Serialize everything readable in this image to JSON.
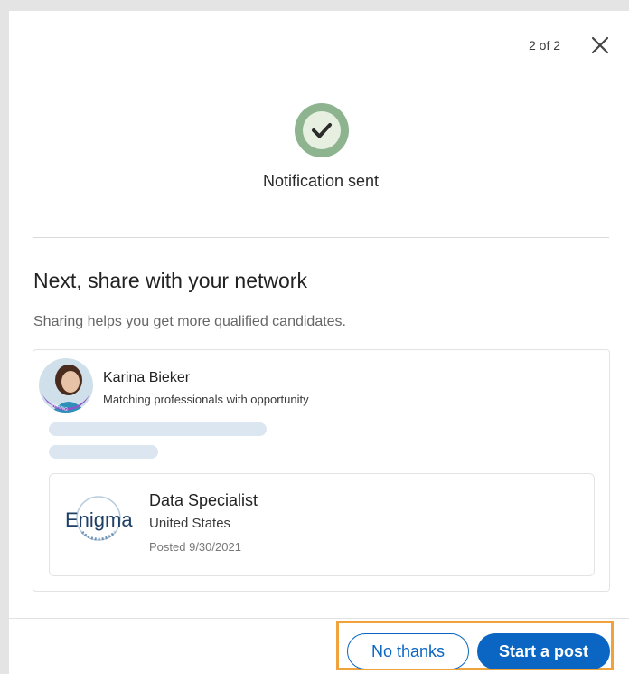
{
  "header": {
    "step_indicator": "2 of 2",
    "close_icon": "close-icon"
  },
  "status": {
    "icon": "checkmark-circle-icon",
    "text": "Notification sent",
    "accent_color": "#8db48f"
  },
  "share": {
    "title": "Next, share with your network",
    "subtitle": "Sharing helps you get more qualified candidates."
  },
  "post_preview": {
    "author_name": "Karina Bieker",
    "author_headline": "Matching professionals with opportunity",
    "avatar_badge": "#HIRING",
    "job": {
      "company_logo_text": "Enigma",
      "title": "Data Specialist",
      "location": "United States",
      "posted": "Posted 9/30/2021"
    }
  },
  "actions": {
    "secondary_label": "No thanks",
    "primary_label": "Start a post",
    "primary_color": "#0a66c2"
  }
}
